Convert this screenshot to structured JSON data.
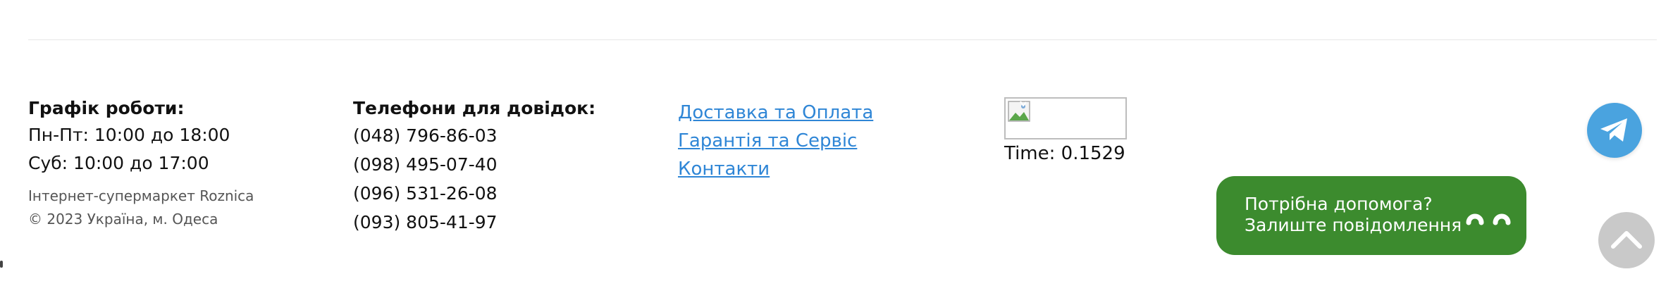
{
  "footer": {
    "hours": {
      "heading": "Графік роботи:",
      "weekdays": "Пн-Пт: 10:00 до 18:00",
      "saturday": "Суб: 10:00 до 17:00",
      "store_name": "Інтернет-супермаркет Roznica",
      "copyright": "© 2023 Україна, м. Одеса"
    },
    "phones": {
      "heading": "Телефони для довідок:",
      "numbers": [
        "(048) 796-86-03",
        "(098) 495-07-40",
        "(096) 531-26-08",
        "(093) 805-41-97"
      ]
    },
    "links": [
      "Доставка та Оплата",
      "Гарантія та Сервіс",
      "Контакти"
    ],
    "counter": {
      "time_text": "Time: 0.1529"
    }
  },
  "help_widget": {
    "line1": "Потрібна допомога?",
    "line2": "Залиште повідомлення"
  },
  "icons": {
    "telegram": "telegram-icon",
    "scroll_top": "chevron-up-icon",
    "broken_image": "broken-image-icon"
  },
  "colors": {
    "link": "#2f86d6",
    "telegram": "#4aa3df",
    "help_widget": "#3c8b2e",
    "scroll_top": "#c9c9c9"
  }
}
